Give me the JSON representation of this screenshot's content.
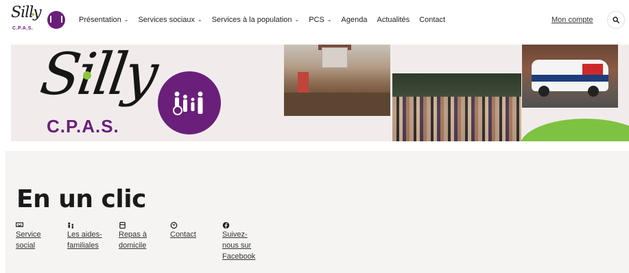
{
  "logo": {
    "wordmark": "Silly",
    "sub": "C.P.A.S."
  },
  "nav": {
    "items": [
      {
        "label": "Présentation",
        "dropdown": true
      },
      {
        "label": "Services sociaux",
        "dropdown": true
      },
      {
        "label": "Services à la population",
        "dropdown": true
      },
      {
        "label": "PCS",
        "dropdown": true
      },
      {
        "label": "Agenda",
        "dropdown": false
      },
      {
        "label": "Actualités",
        "dropdown": false
      },
      {
        "label": "Contact",
        "dropdown": false
      }
    ],
    "chevron": "⌄",
    "account_label": "Mon compte",
    "search_icon": "search-icon"
  },
  "hero": {
    "wordmark": "Silly",
    "sub": "C.P.A.S."
  },
  "section": {
    "title": "En un clic",
    "links": [
      {
        "label": "Service social",
        "icon": "handshake-icon"
      },
      {
        "label": "Les aides-familiales",
        "icon": "family-icon"
      },
      {
        "label": "Repas à domicile",
        "icon": "meal-icon"
      },
      {
        "label": "Contact",
        "icon": "phone-icon"
      },
      {
        "label": "Suivez-nous sur Facebook",
        "icon": "facebook-icon"
      }
    ]
  },
  "colors": {
    "brand_purple": "#6a1f7a",
    "brand_green": "#8cc63f",
    "hero_bg": "#f1eceb",
    "section_bg": "#f5f4f3"
  }
}
